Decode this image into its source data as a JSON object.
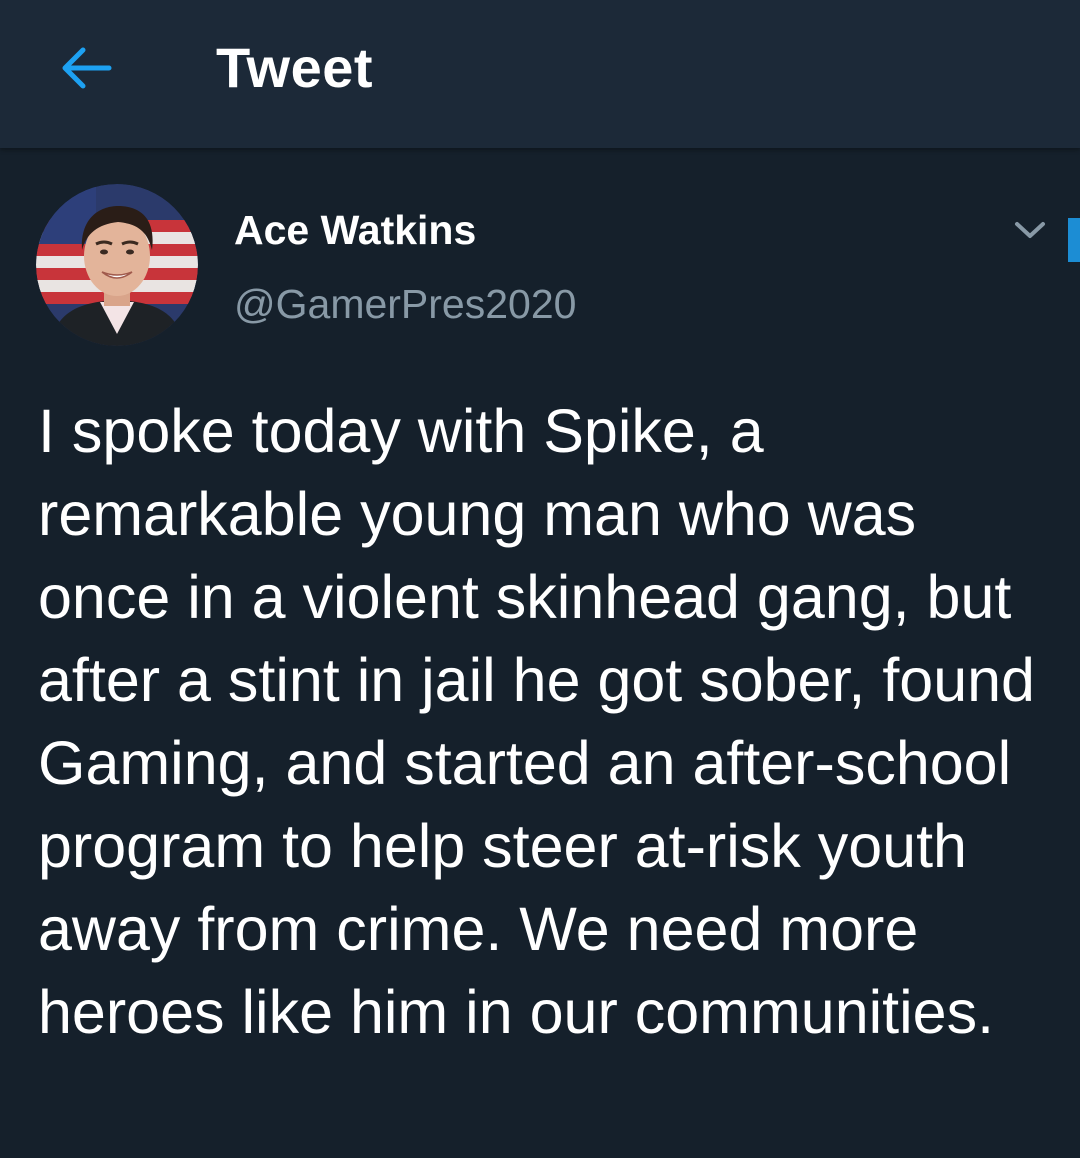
{
  "header": {
    "title": "Tweet",
    "back_icon": "arrow-left-icon",
    "accent_color": "#1da1f2"
  },
  "tweet": {
    "author": {
      "display_name": "Ace Watkins",
      "handle": "@GamerPres2020",
      "avatar": "avatar-photo"
    },
    "menu_icon": "chevron-down-icon",
    "text": "I spoke today with Spike, a remarkable young man who was once in a violent skinhead gang, but after a stint in jail he got sober, found Gaming, and started an after-school program to help steer at-risk youth away from crime. We need more heroes like him in our communities."
  },
  "colors": {
    "background": "#15202b",
    "header_background": "#1c2938",
    "secondary_text": "#8899a6"
  }
}
